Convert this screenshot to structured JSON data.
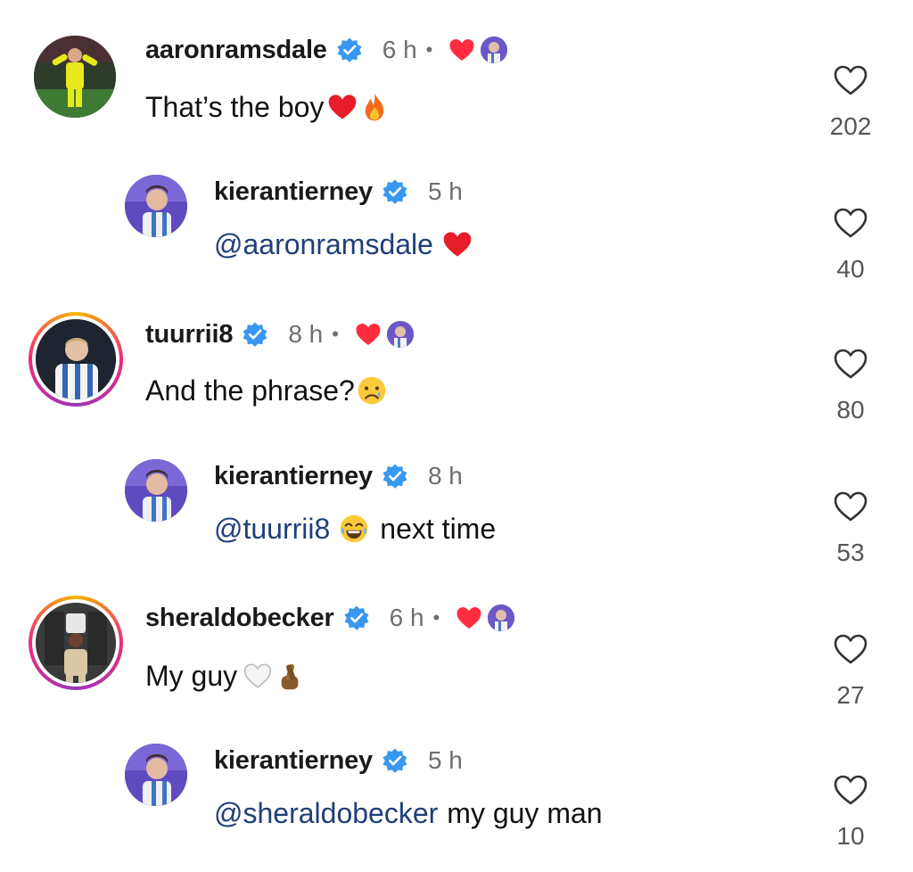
{
  "comments": [
    {
      "username": "aaronramsdale",
      "time": "6 h",
      "dot": "•",
      "text": "That’s the boy",
      "likes": "202",
      "creator_liked": true
    },
    {
      "username": "kierantierney",
      "time": "5 h",
      "mention": "@aaronramsdale",
      "text": "",
      "likes": "40",
      "creator_liked": false
    },
    {
      "username": "tuurrii8",
      "time": "8 h",
      "dot": "•",
      "text": "And the phrase?",
      "likes": "80",
      "creator_liked": true
    },
    {
      "username": "kierantierney",
      "time": "8 h",
      "mention": "@tuurrii8",
      "text": "next time",
      "likes": "53",
      "creator_liked": false
    },
    {
      "username": "sheraldobecker",
      "time": "6 h",
      "dot": "•",
      "text": "My guy",
      "likes": "27",
      "creator_liked": true
    },
    {
      "username": "kierantierney",
      "time": "5 h",
      "mention": "@sheraldobecker",
      "text": "my guy man",
      "likes": "10",
      "creator_liked": false
    }
  ],
  "colors": {
    "verified_blue": "#3897f0",
    "like_red": "#ff2d3d",
    "mention_blue": "#1f3f78",
    "meta_gray": "#6e6e6e"
  },
  "icons": {
    "verified": "verified-badge-icon",
    "like": "heart-outline-icon",
    "liked_by_creator": "heart-filled-icon"
  }
}
